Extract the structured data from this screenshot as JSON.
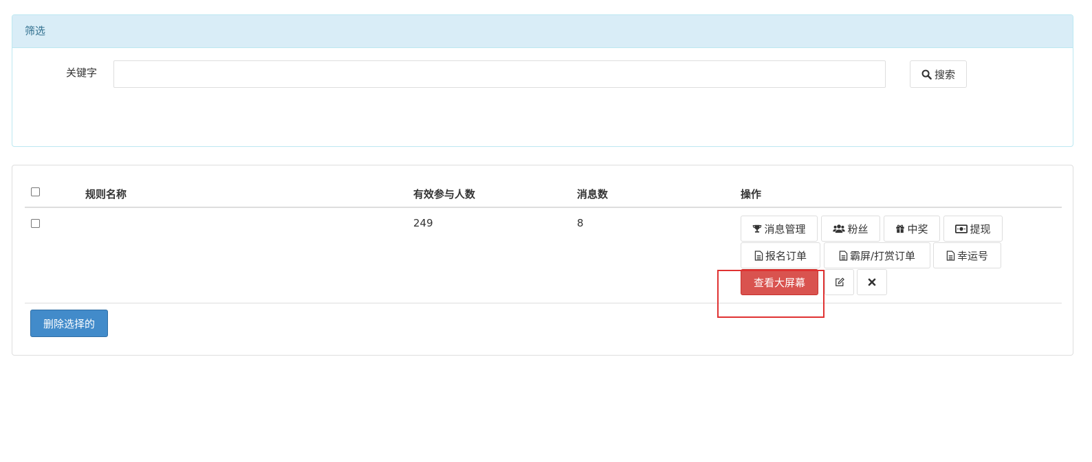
{
  "filter": {
    "heading": "筛选",
    "keyword_label": "关键字",
    "keyword_value": "",
    "keyword_placeholder": "",
    "search_label": "搜索"
  },
  "table": {
    "headers": [
      "规则名称",
      "有效参与人数",
      "消息数",
      "操作"
    ],
    "rows": [
      {
        "name": "",
        "participants": "249",
        "messages": "8"
      }
    ],
    "actions": {
      "message_manage": "消息管理",
      "fans": "粉丝",
      "prize": "中奖",
      "withdraw": "提现",
      "signup_orders": "报名订单",
      "screen_reward_orders": "霸屏/打赏订单",
      "lucky_number": "幸运号",
      "view_big_screen": "查看大屏幕"
    },
    "delete_selected": "删除选择的"
  },
  "icons": {
    "search": "search-icon",
    "message_manage": "trophy-icon",
    "fans": "users-icon",
    "prize": "gift-icon",
    "withdraw": "money-icon",
    "document": "file-text-icon",
    "edit": "edit-icon",
    "delete": "close-icon"
  },
  "colors": {
    "filter_heading_bg": "#d9edf7",
    "filter_heading_text": "#31708f",
    "danger": "#d9534f",
    "primary": "#428bca",
    "highlight": "#e03131"
  }
}
